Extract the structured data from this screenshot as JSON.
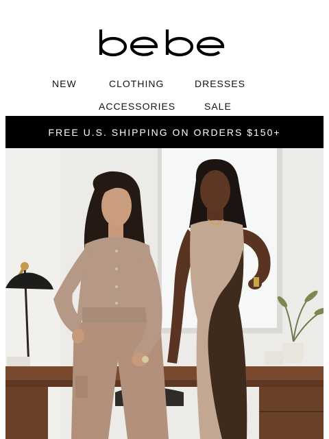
{
  "brand": {
    "logo_text": "bebe"
  },
  "nav": {
    "row1": [
      {
        "label": "NEW"
      },
      {
        "label": "CLOTHING"
      },
      {
        "label": "DRESSES"
      }
    ],
    "row2": [
      {
        "label": "ACCESSORIES"
      },
      {
        "label": "SALE"
      }
    ]
  },
  "promo_banner": {
    "text": "FREE U.S. SHIPPING ON ORDERS $150+"
  },
  "hero": {
    "description_icon": "hero-photo",
    "colors": {
      "wall": "#ecebe8",
      "window": "#f6f7f7",
      "desk": "#7a4a2e",
      "jumpsuit": "#b59886",
      "dress_beige": "#c2a893",
      "dress_brown": "#3f2a1e",
      "skin_light": "#c79a7b",
      "skin_dark": "#5a3422",
      "hair": "#1c1410"
    }
  }
}
